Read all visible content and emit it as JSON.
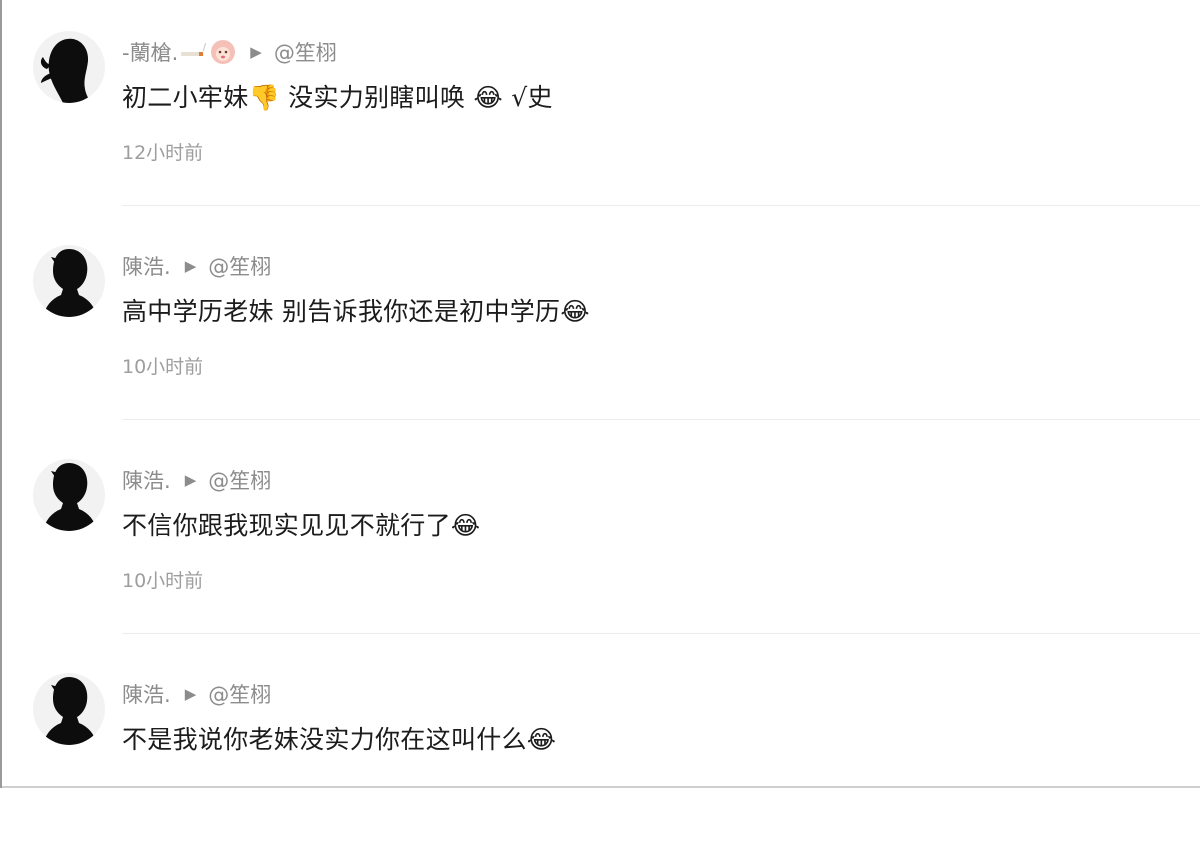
{
  "comments": [
    {
      "username": "-蘭槍.",
      "reply_to": "@笙栩",
      "text": "初二小牢妹👎 没实力别瞎叫唤 😂 √史",
      "time": "12小时前",
      "avatar_icon": "silhouette-avatar-icon"
    },
    {
      "username": "陳浩.",
      "reply_to": "@笙栩",
      "text": "高中学历老妹 别告诉我你还是初中学历😂",
      "time": "10小时前",
      "avatar_icon": "silhouette-avatar-icon"
    },
    {
      "username": "陳浩.",
      "reply_to": "@笙栩",
      "text": "不信你跟我现实见见不就行了😂",
      "time": "10小时前",
      "avatar_icon": "silhouette-avatar-icon"
    },
    {
      "username": "陳浩.",
      "reply_to": "@笙栩",
      "text": "不是我说你老妹没实力你在这叫什么😂",
      "time": "",
      "avatar_icon": "silhouette-avatar-icon"
    }
  ],
  "reply_arrow_glyph": "▶",
  "colors": {
    "username": "#8c8c8c",
    "text": "#1c1c1c",
    "time": "#9e9e9e",
    "divider": "#ececec"
  }
}
